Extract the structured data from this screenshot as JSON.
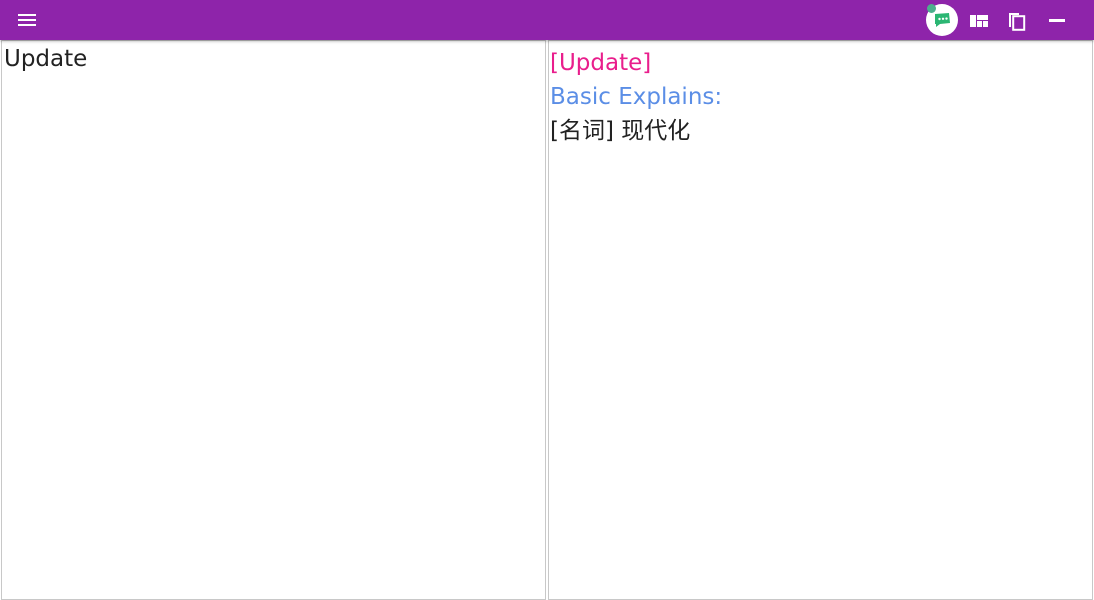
{
  "toolbar": {
    "menu_icon": "hamburger-menu-icon",
    "avatar_icon": "chat-bubble-icon",
    "layout_icon": "layout-grid-icon",
    "copy_icon": "copy-icon",
    "minimize_icon": "minimize-icon",
    "accent_color": "#8e24aa"
  },
  "source": {
    "text": "Update"
  },
  "result": {
    "word": "[Update]",
    "section_title": "Basic Explains:",
    "explains": [
      "[名词] 现代化"
    ],
    "word_color": "#e91e8c",
    "section_color": "#5b8ee6"
  }
}
